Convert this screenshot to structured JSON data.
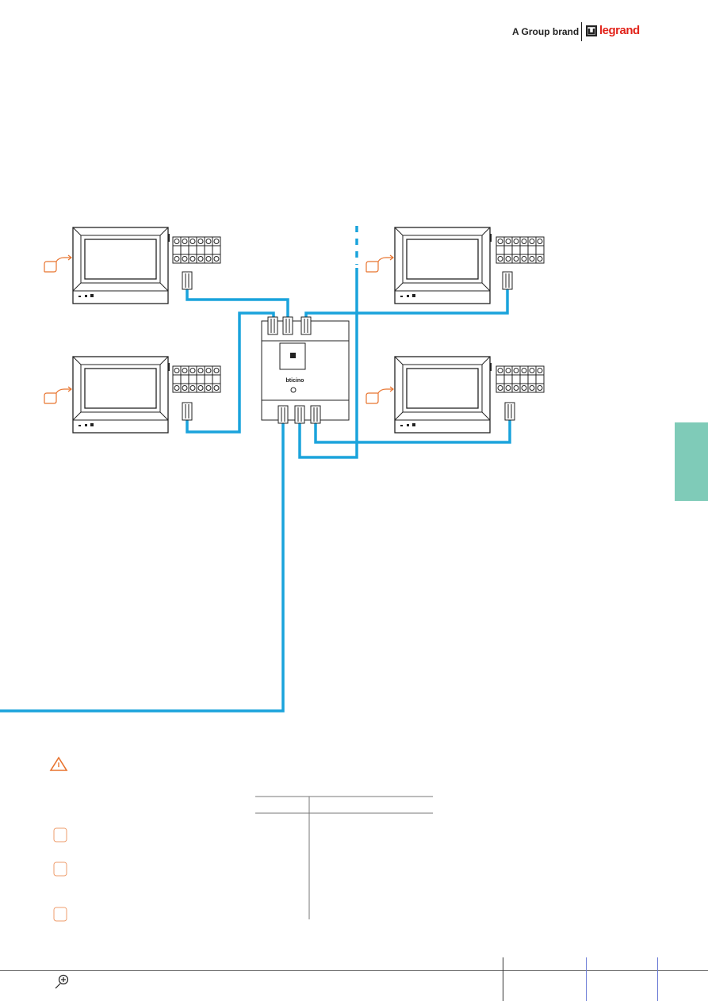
{
  "header": {
    "brand_tagline": "A Group brand",
    "logo_text": "legrand"
  },
  "diagram": {
    "device_brand": "bticino",
    "wire_color": "#1aa3dc",
    "accent_color": "#e8742f",
    "side_tab_color": "#7fcbb8"
  },
  "footer": {
    "zoom_icon": "magnifier-plus-icon"
  }
}
